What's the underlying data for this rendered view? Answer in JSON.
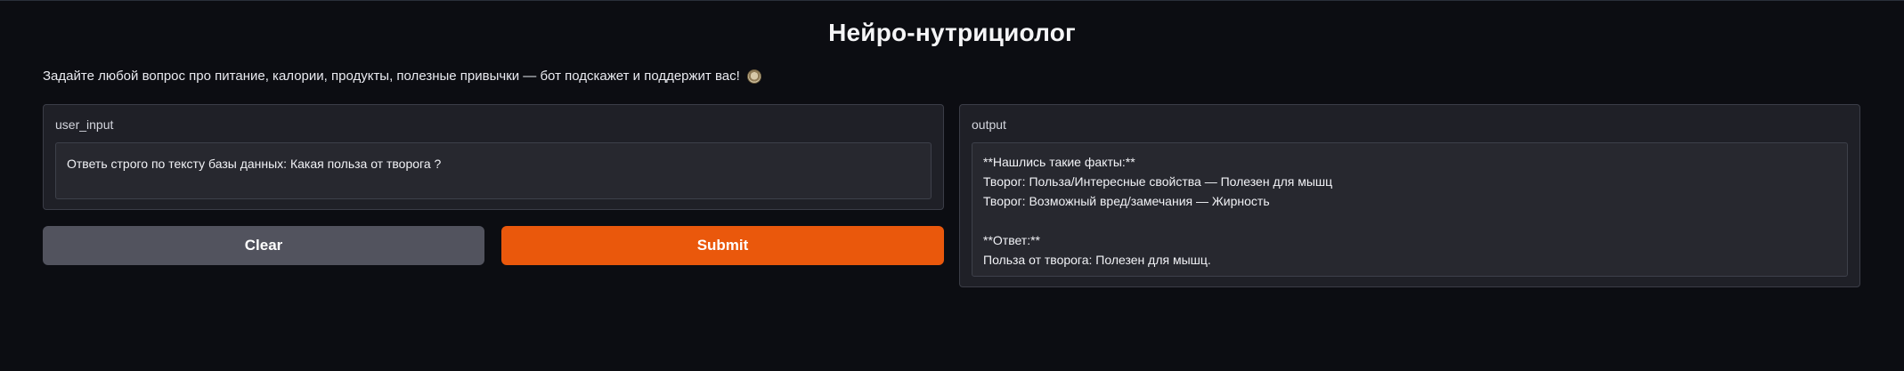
{
  "app": {
    "title": "Нейро-нутрициолог",
    "description": "Задайте любой вопрос про питание, калории, продукты, полезные привычки — бот подскажет и поддержит вас!",
    "description_icon": "bowl-food-icon"
  },
  "input": {
    "label": "user_input",
    "value": "Ответь строго по тексту базы данных:  Какая польза от творога ?"
  },
  "buttons": {
    "clear_label": "Clear",
    "submit_label": "Submit"
  },
  "output": {
    "label": "output",
    "text": "**Нашлись такие факты:**\nТворог: Польза/Интересные свойства — Полезен для мышц\nТворог: Возможный вред/замечания — Жирность\n\n**Ответ:**\nПольза от творога: Полезен для мышц."
  },
  "colors": {
    "background": "#0c0d12",
    "panel": "#1f2027",
    "submit": "#ea580c",
    "clear": "#52535e"
  }
}
